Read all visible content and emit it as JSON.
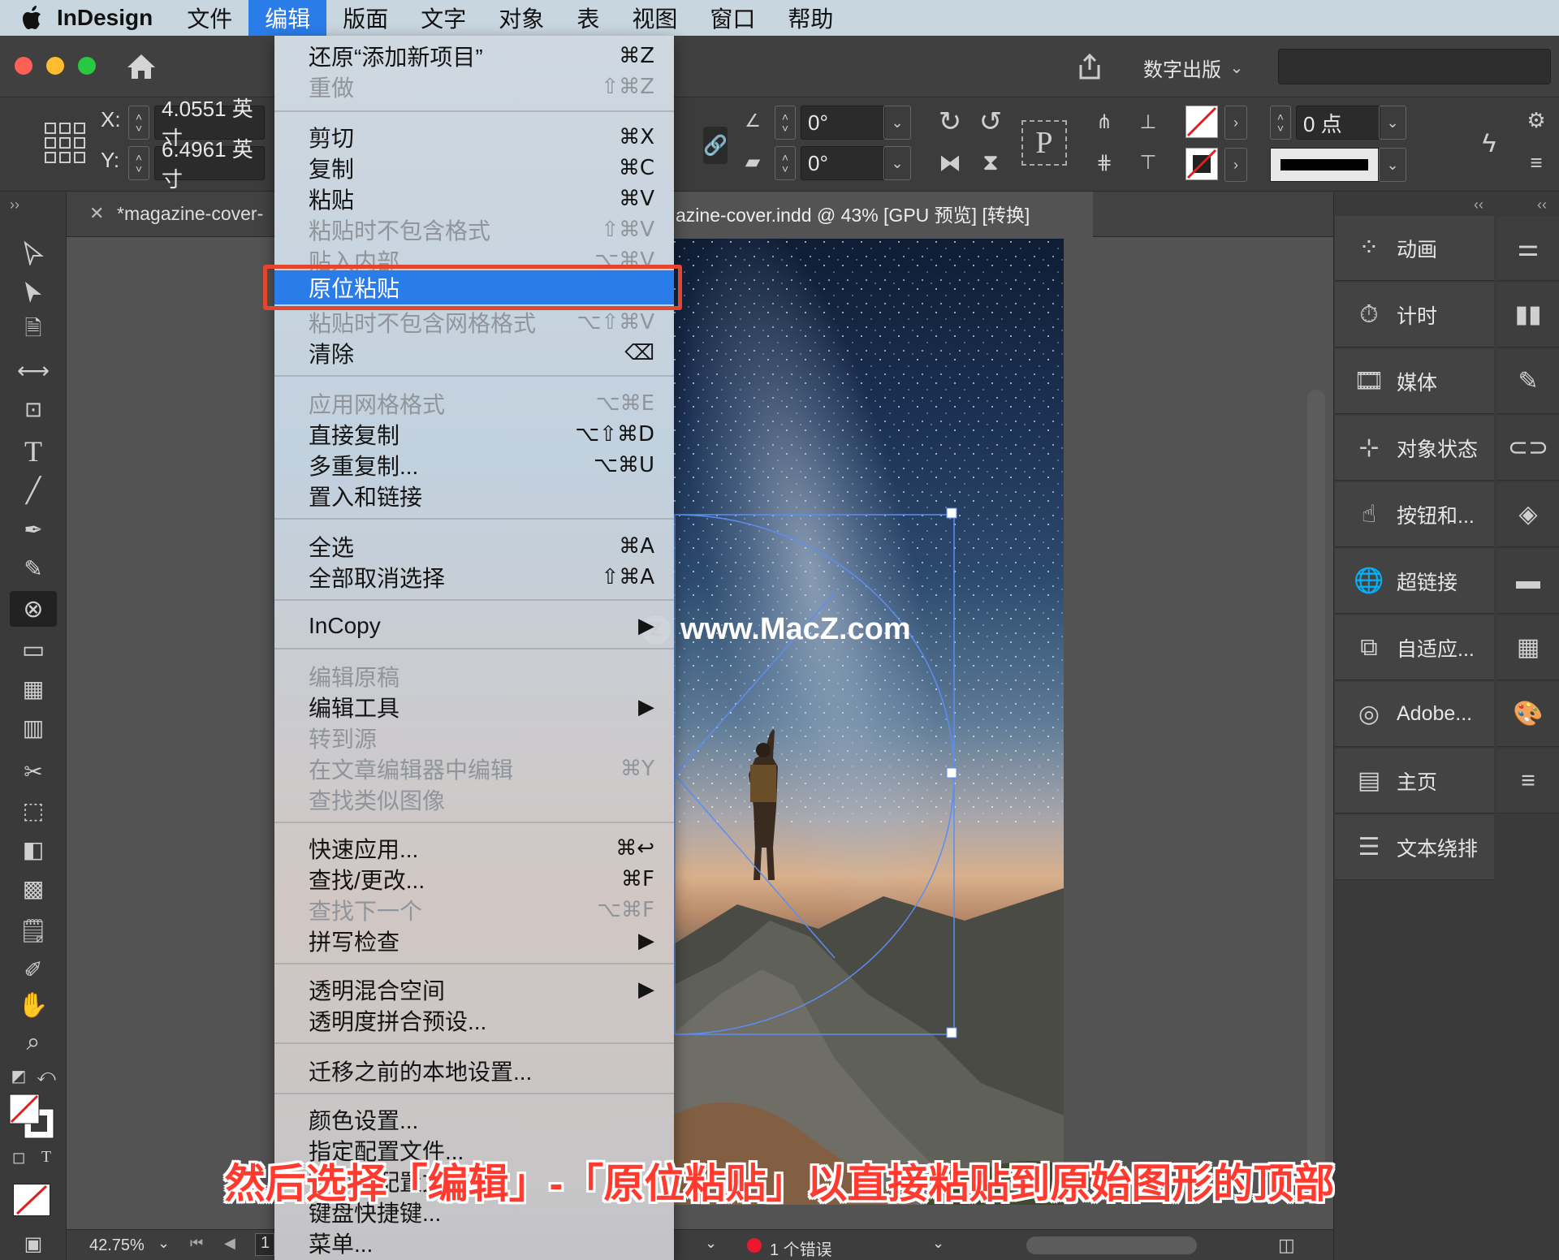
{
  "menubar": {
    "apple": "",
    "app": "InDesign",
    "items": [
      "文件",
      "编辑",
      "版面",
      "文字",
      "对象",
      "表",
      "视图",
      "窗口",
      "帮助"
    ]
  },
  "titlebar": {
    "publish": "数字出版",
    "search_value": ""
  },
  "control": {
    "x_label": "X:",
    "x_value": "4.0551 英寸",
    "y_label": "Y:",
    "y_value": "6.4961 英寸",
    "angle1": "0°",
    "angle2": "0°",
    "stroke_weight": "0 点",
    "p_label": "P"
  },
  "tabs": {
    "tab1": "*magazine-cover-",
    "tab2": "azine-cover.indd @ 43% [GPU 预览] [转换]"
  },
  "status": {
    "zoom": "42.75%",
    "page": "1",
    "errors": "1 个错误"
  },
  "watermark": {
    "badge": "Z",
    "text": "www.MacZ.com"
  },
  "menu": [
    {
      "label": "还原“添加新项目”",
      "shortcut": "⌘Z",
      "disabled": false
    },
    {
      "label": "重做",
      "shortcut": "⇧⌘Z",
      "disabled": true
    },
    {
      "label": "剪切",
      "shortcut": "⌘X",
      "disabled": false
    },
    {
      "label": "复制",
      "shortcut": "⌘C",
      "disabled": false
    },
    {
      "label": "粘贴",
      "shortcut": "⌘V",
      "disabled": false
    },
    {
      "label": "粘贴时不包含格式",
      "shortcut": "⇧⌘V",
      "disabled": true
    },
    {
      "label": "贴入内部",
      "shortcut": "⌥⌘V",
      "disabled": true
    },
    {
      "label": "原位粘贴",
      "shortcut": "",
      "disabled": false
    },
    {
      "label": "粘贴时不包含网格格式",
      "shortcut": "⌥⇧⌘V",
      "disabled": true
    },
    {
      "label": "清除",
      "shortcut": "⌫",
      "disabled": false
    },
    {
      "label": "应用网格格式",
      "shortcut": "⌥⌘E",
      "disabled": true
    },
    {
      "label": "直接复制",
      "shortcut": "⌥⇧⌘D",
      "disabled": false
    },
    {
      "label": "多重复制...",
      "shortcut": "⌥⌘U",
      "disabled": false
    },
    {
      "label": "置入和链接",
      "shortcut": "",
      "disabled": false
    },
    {
      "label": "全选",
      "shortcut": "⌘A",
      "disabled": false
    },
    {
      "label": "全部取消选择",
      "shortcut": "⇧⌘A",
      "disabled": false
    },
    {
      "label": "InCopy",
      "shortcut": "▶",
      "disabled": false
    },
    {
      "label": "编辑原稿",
      "shortcut": "",
      "disabled": true
    },
    {
      "label": "编辑工具",
      "shortcut": "▶",
      "disabled": false
    },
    {
      "label": "转到源",
      "shortcut": "",
      "disabled": true
    },
    {
      "label": "在文章编辑器中编辑",
      "shortcut": "⌘Y",
      "disabled": true
    },
    {
      "label": "查找类似图像",
      "shortcut": "",
      "disabled": true
    },
    {
      "label": "快速应用...",
      "shortcut": "⌘↩",
      "disabled": false
    },
    {
      "label": "查找/更改...",
      "shortcut": "⌘F",
      "disabled": false
    },
    {
      "label": "查找下一个",
      "shortcut": "⌥⌘F",
      "disabled": true
    },
    {
      "label": "拼写检查",
      "shortcut": "▶",
      "disabled": false
    },
    {
      "label": "透明混合空间",
      "shortcut": "▶",
      "disabled": false
    },
    {
      "label": "透明度拼合预设...",
      "shortcut": "",
      "disabled": false
    },
    {
      "label": "迁移之前的本地设置...",
      "shortcut": "",
      "disabled": false
    },
    {
      "label": "颜色设置...",
      "shortcut": "",
      "disabled": false
    },
    {
      "label": "指定配置文件...",
      "shortcut": "",
      "disabled": false
    },
    {
      "label": "转换为配置文件...",
      "shortcut": "",
      "disabled": false
    },
    {
      "label": "键盘快捷键...",
      "shortcut": "",
      "disabled": false
    },
    {
      "label": "菜单...",
      "shortcut": "",
      "disabled": false
    }
  ],
  "panels": [
    "动画",
    "计时",
    "媒体",
    "对象状态",
    "按钮和...",
    "超链接",
    "自适应...",
    "Adobe...",
    "主页",
    "文本绕排"
  ],
  "caption": "然后选择「编辑」-「原位粘贴」以直接粘贴到原始图形的顶部"
}
